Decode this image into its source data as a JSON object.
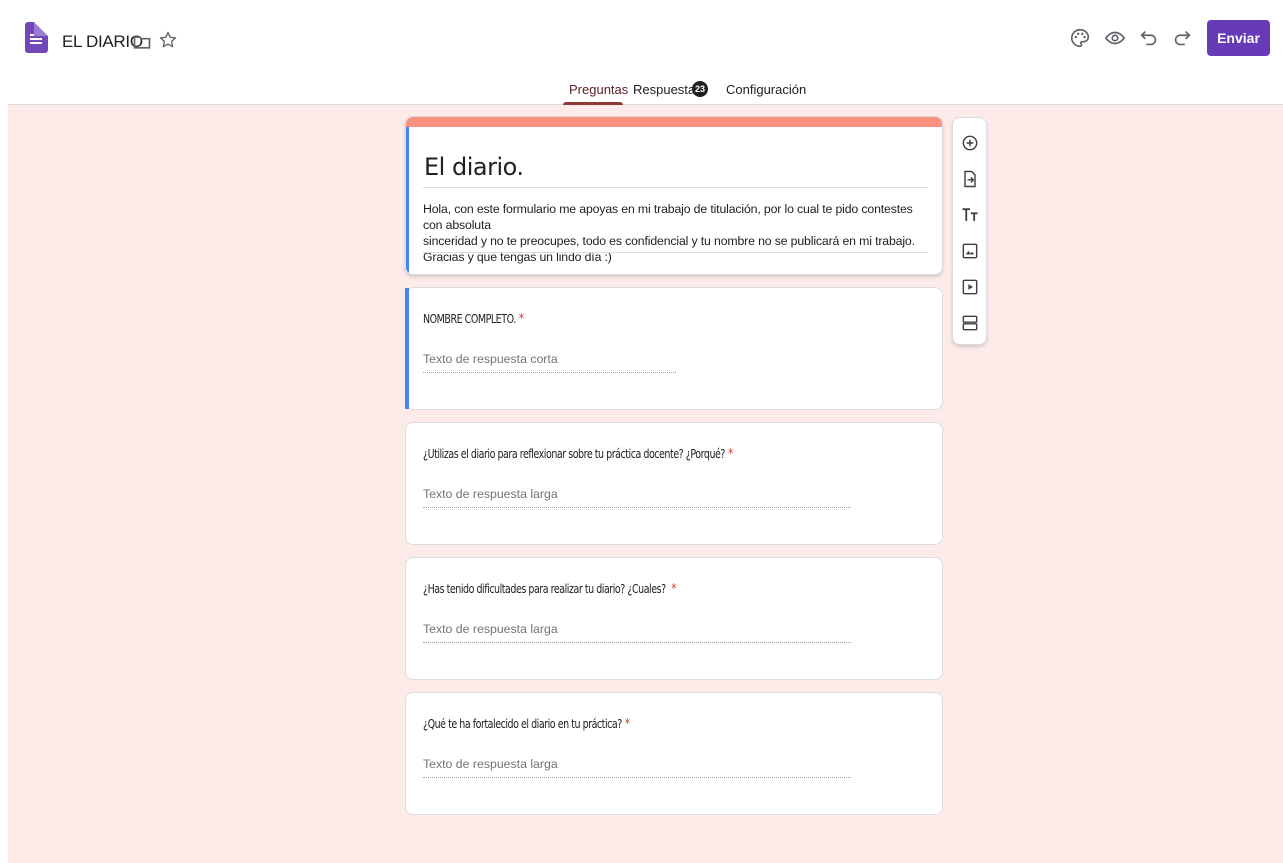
{
  "app": {
    "title": "EL DIARIO",
    "brand_color": "#673ab7",
    "icons": [
      "forms-app-icon",
      "folder-icon",
      "star-icon"
    ]
  },
  "toolbar": {
    "icons": [
      "palette-icon",
      "preview-eye-icon",
      "undo-icon",
      "redo-icon"
    ],
    "send_label": "Enviar"
  },
  "tabs": [
    {
      "label": "Preguntas",
      "active": true
    },
    {
      "label": "Respuestas",
      "badge": "23"
    },
    {
      "label": "Configuración"
    }
  ],
  "form": {
    "title": "El diario.",
    "description_lines": [
      "Hola, con este formulario me apoyas en mi trabajo de titulación, por lo cual te pido contestes con absoluta",
      "sinceridad y no te preocupes, todo es confidencial y tu nombre no se publicará en mi trabajo.",
      "Gracias y que tengas un lindo día :)"
    ],
    "header_color": "#fa907e",
    "background_color": "#fdebe9"
  },
  "questions": [
    {
      "label": "NOMBRE COMPLETO.",
      "required": "*",
      "placeholder": "Texto de respuesta corta"
    },
    {
      "label": "¿Utilizas el diario para reflexionar sobre tu práctica docente? ¿Porqué?",
      "required": "*",
      "placeholder": "Texto de respuesta larga"
    },
    {
      "label": "¿Has tenido dificultades para realizar tu diario? ¿Cuales? ",
      "required": "*",
      "placeholder": "Texto de respuesta larga"
    },
    {
      "label": "¿Qué te ha fortalecido el diario en tu práctica?",
      "required": "*",
      "placeholder": "Texto de respuesta larga"
    }
  ],
  "side_toolbar": {
    "icons": [
      "add-question-icon",
      "import-questions-icon",
      "add-title-icon",
      "add-image-icon",
      "add-video-icon",
      "add-section-icon"
    ]
  }
}
